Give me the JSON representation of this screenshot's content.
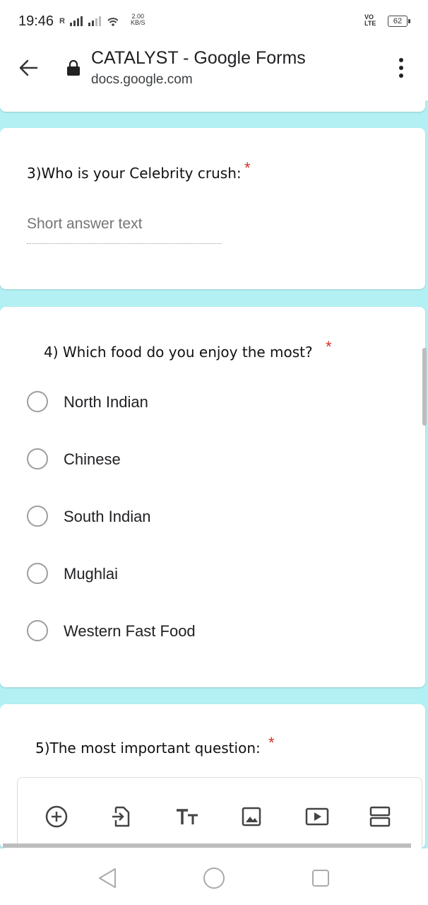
{
  "status_bar": {
    "time": "19:46",
    "signal_label": "R",
    "speed_value": "2.00",
    "speed_unit": "KB/S",
    "volte_top": "VO",
    "volte_bottom": "LTE",
    "battery": "62"
  },
  "browser": {
    "page_title": "CATALYST - Google Forms",
    "domain": "docs.google.com"
  },
  "form": {
    "required_mark": "*",
    "q3": {
      "title": "3)Who is your Celebrity crush:",
      "placeholder": "Short answer text"
    },
    "q4": {
      "title": "4) Which food do you enjoy the most?",
      "options": [
        "North Indian",
        "Chinese",
        "South Indian",
        "Mughlai",
        "Western Fast Food"
      ]
    },
    "q5": {
      "title": "5)The most important question:"
    }
  },
  "toolbar": {
    "icons": [
      "add-question-icon",
      "import-questions-icon",
      "add-title-icon",
      "add-image-icon",
      "add-video-icon",
      "add-section-icon"
    ]
  },
  "colors": {
    "page_background": "#b2f0f3",
    "required": "#d93025"
  }
}
